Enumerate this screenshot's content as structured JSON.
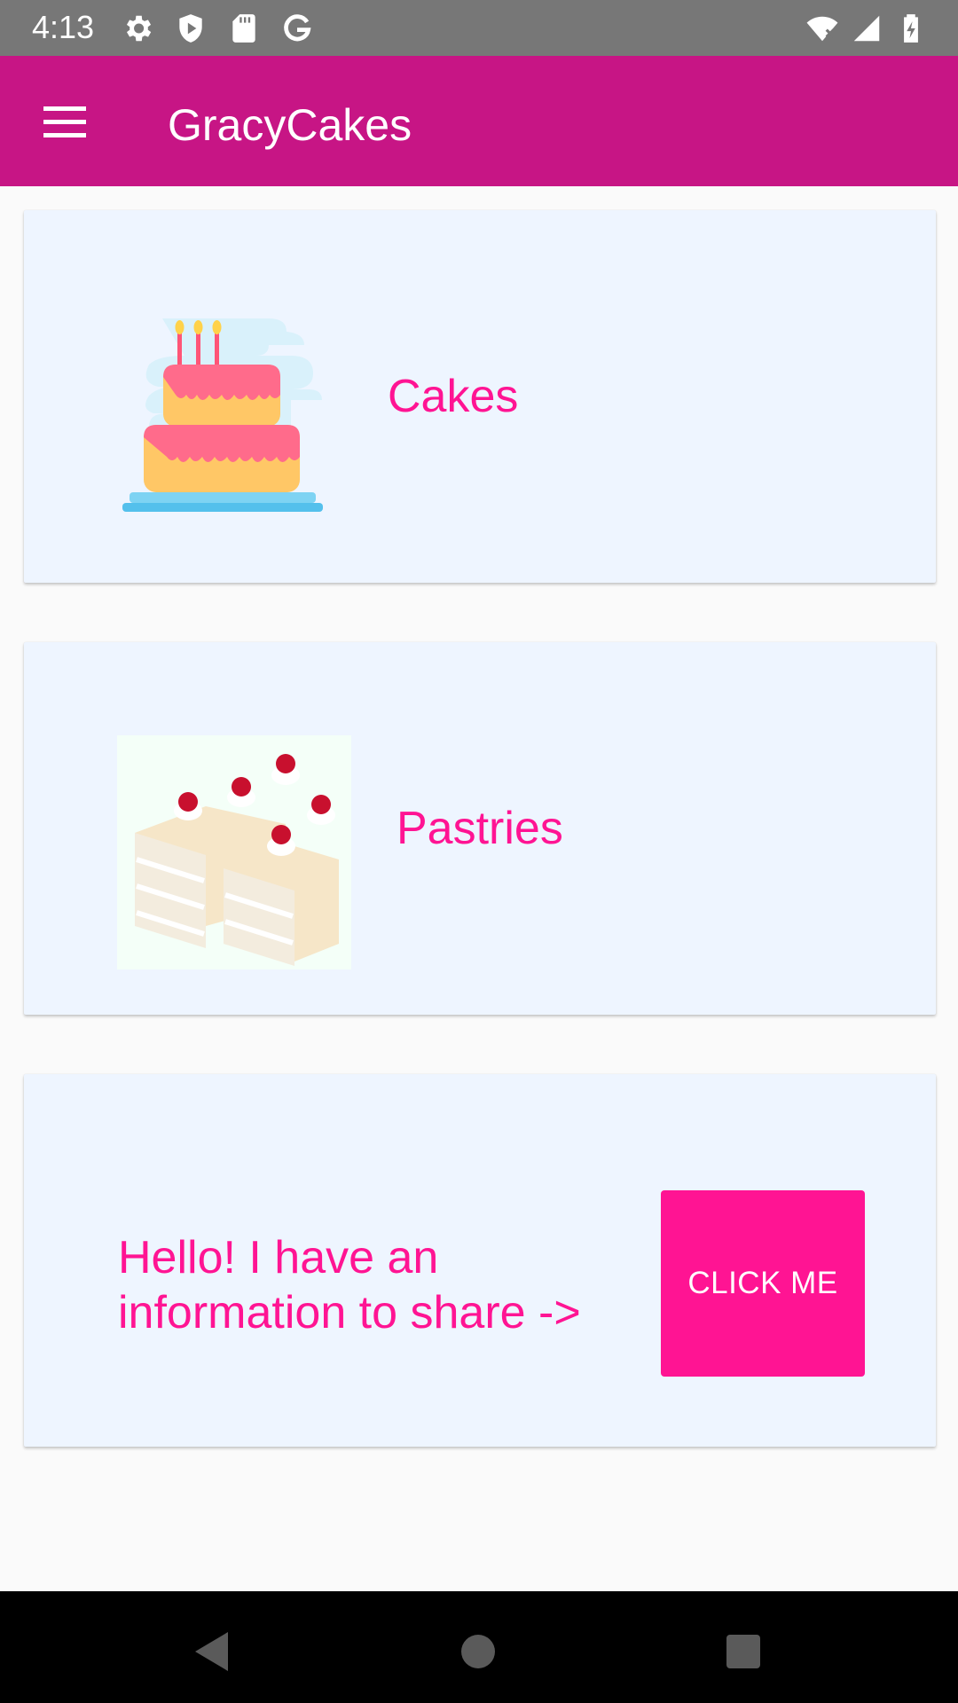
{
  "status_bar": {
    "time": "4:13",
    "left_icons": [
      "settings-icon",
      "shield-icon",
      "sd-card-icon",
      "google-icon"
    ],
    "right_icons": [
      "wifi-icon",
      "signal-icon",
      "battery-icon"
    ]
  },
  "app_bar": {
    "title": "GracyCakes",
    "menu_icon": "hamburger-menu-icon",
    "background": "#c71585"
  },
  "cards": {
    "cakes": {
      "label": "Cakes",
      "image": "birthday-cake-illustration"
    },
    "pastries": {
      "label": "Pastries",
      "image": "pastries-photo"
    },
    "info": {
      "text": "Hello! I have an information to share ->",
      "button_label": "CLICK ME"
    }
  },
  "colors": {
    "accent": "#ff1493",
    "card_background": "#eef5ff",
    "page_background": "#fafafa"
  },
  "nav_bar": {
    "buttons": [
      "back-icon",
      "home-icon",
      "recents-icon"
    ]
  }
}
